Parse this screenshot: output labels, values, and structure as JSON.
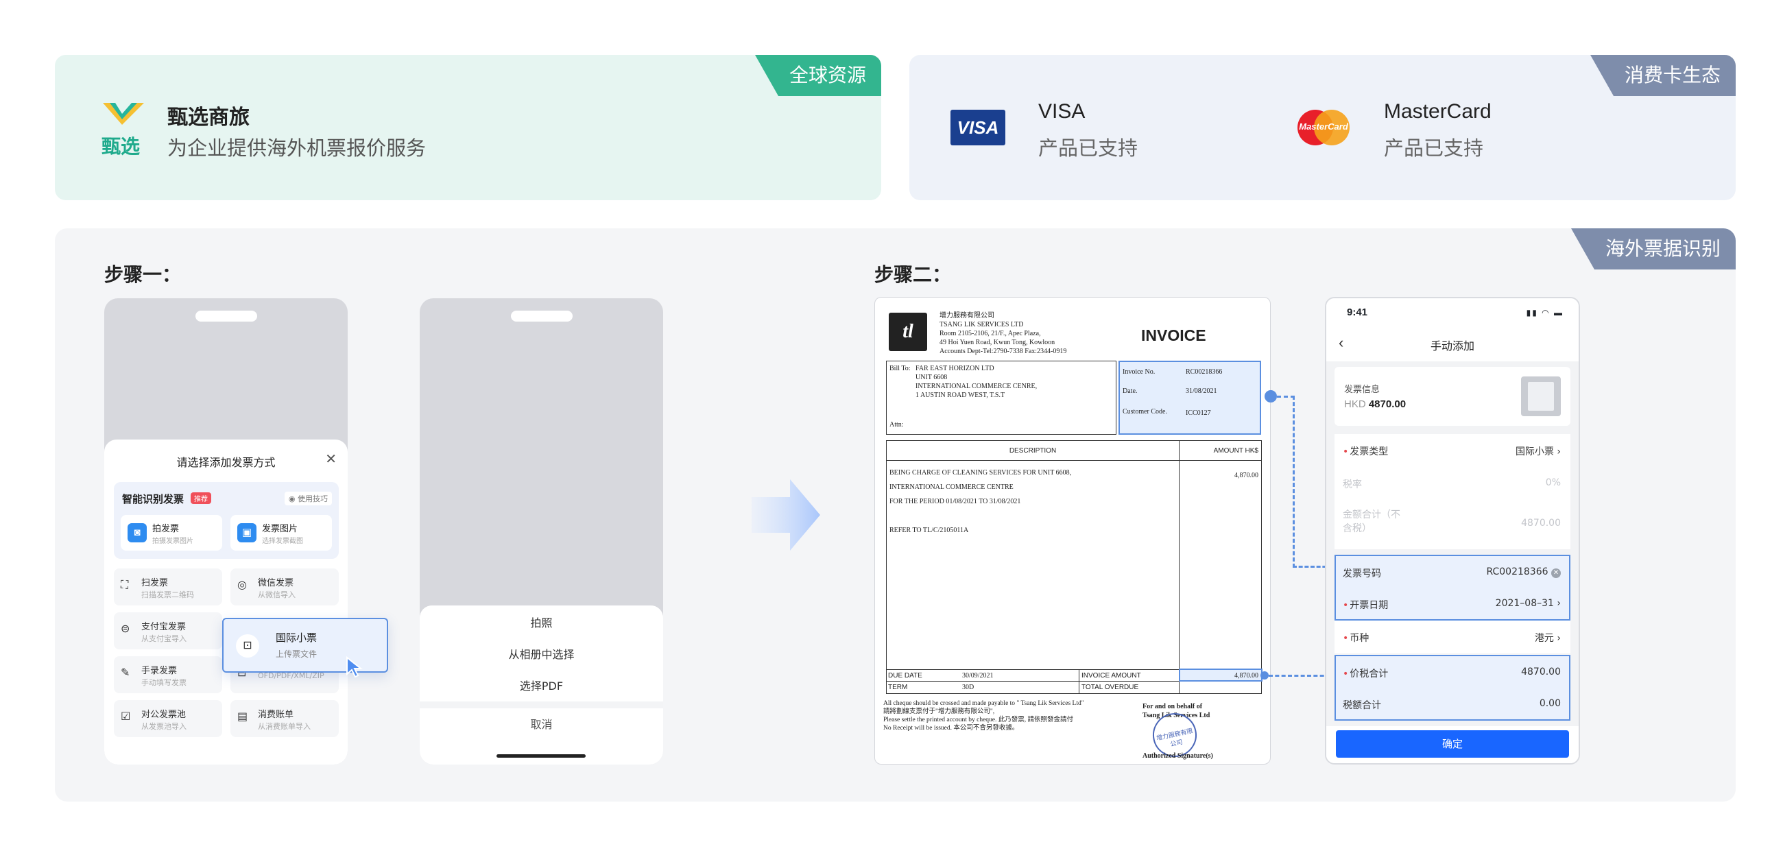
{
  "top_left": {
    "tag": "全球资源",
    "brand_name": "甄选商旅",
    "logo_text": "甄选",
    "description": "为企业提供海外机票报价服务"
  },
  "top_right": {
    "tag": "消费卡生态",
    "visa": {
      "logo": "VISA",
      "name": "VISA",
      "status": "产品已支持"
    },
    "mastercard": {
      "logo": "MasterCard",
      "name": "MasterCard",
      "status": "产品已支持"
    }
  },
  "panel": {
    "tag": "海外票据识别",
    "step1_title": "步骤一：",
    "step2_title": "步骤二："
  },
  "phone1": {
    "sheet_title": "请选择添加发票方式",
    "smart_title": "智能识别发票",
    "recommend_badge": "推荐",
    "tips": "使用技巧",
    "take_photo": {
      "title": "拍发票",
      "sub": "拍摄发票图片"
    },
    "invoice_image": {
      "title": "发票图片",
      "sub": "选择发票截图"
    },
    "options": [
      {
        "title": "扫发票",
        "sub": "扫描发票二维码"
      },
      {
        "title": "微信发票",
        "sub": "从微信导入"
      },
      {
        "title": "支付宝发票",
        "sub": "从支付宝导入"
      },
      {
        "title": "",
        "sub": "OFD/PDF/XML/ZIP"
      },
      {
        "title": "手录发票",
        "sub": "手动填写发票"
      },
      {
        "title": "对公发票池",
        "sub": "从发票池导入"
      },
      {
        "title": "消费账单",
        "sub": "从消费账单导入"
      }
    ],
    "popup": {
      "title": "国际小票",
      "sub": "上传票文件"
    }
  },
  "phone2": {
    "actions": [
      "拍照",
      "从相册中选择",
      "选择PDF"
    ],
    "cancel": "取消"
  },
  "invoice": {
    "company_cn": "增力服務有限公司",
    "company_en": "TSANG LIK SERVICES LTD",
    "addr1": "Room 2105-2106, 21/F., Apec Plaza,",
    "addr2": "49 Hoi Yuen Road, Kwun Tong, Kowloon",
    "contact": "Accounts Dept-Tel:2790-7338  Fax:2344-0919",
    "title": "INVOICE",
    "bill_to_label": "Bill To:",
    "bill_to": [
      "FAR EAST HORIZON LTD",
      "UNIT 6608",
      "INTERNATIONAL COMMERCE CENRE,",
      "1 AUSTIN ROAD WEST, T.S.T"
    ],
    "attn": "Attn:",
    "invoice_no_label": "Invoice No.",
    "invoice_no": "RC00218366",
    "date_label": "Date.",
    "date": "31/08/2021",
    "customer_code_label": "Customer Code.",
    "customer_code": "ICC0127",
    "desc_header": "DESCRIPTION",
    "amount_header": "AMOUNT HK$",
    "lines": [
      "BEING CHARGE OF CLEANING SERVICES FOR UNIT 6608,",
      "INTERNATIONAL COMMERCE CENTRE",
      "FOR THE PERIOD 01/08/2021 TO 31/08/2021",
      "REFER TO TL/C/2105011A"
    ],
    "line_amount": "4,870.00",
    "due_date_label": "DUE DATE",
    "due_date": "30/09/2021",
    "invoice_amount_label": "INVOICE AMOUNT",
    "invoice_amount": "4,870.00",
    "term_label": "TERM",
    "term": "30D",
    "total_overdue_label": "TOTAL OVERDUE",
    "footer1": "All cheque should be crossed and made payable to \" Tsang Lik Services Ltd\"",
    "footer2": "請將劃線支票付于\"增力服務有限公司\",",
    "footer3": "Please settle the printed account by cheque. 此乃發票,  請依照發金請付",
    "footer4": "No Receipt will be issued. 本公司不會另發收據。",
    "sign_for": "For and on behalf of",
    "sign_company": "Tsang Lik Services Ltd",
    "stamp": "增力服務有限公司",
    "authorized": "Authorized Signature(s)"
  },
  "mobile_form": {
    "time": "9:41",
    "title": "手动添加",
    "info_label": "发票信息",
    "currency": "HKD",
    "amount": "4870.00",
    "rows": [
      {
        "label": "发票类型",
        "value": "国际小票",
        "required": true
      },
      {
        "label": "税率",
        "value": "0%",
        "required": false
      },
      {
        "label": "金额合计（不含税）",
        "value": "4870.00",
        "required": false
      },
      {
        "label": "发票号码",
        "value": "RC00218366",
        "required": false
      },
      {
        "label": "开票日期",
        "value": "2021–08–31",
        "required": true
      },
      {
        "label": "币种",
        "value": "港元",
        "required": true
      },
      {
        "label": "价税合计",
        "value": "4870.00",
        "required": true
      },
      {
        "label": "税额合计",
        "value": "0.00",
        "required": false
      }
    ],
    "confirm": "确定"
  },
  "colors": {
    "green": "#33b58f",
    "slate": "#7e8dab",
    "blue_primary": "#1966ff",
    "highlight": "#5b8fe0"
  }
}
